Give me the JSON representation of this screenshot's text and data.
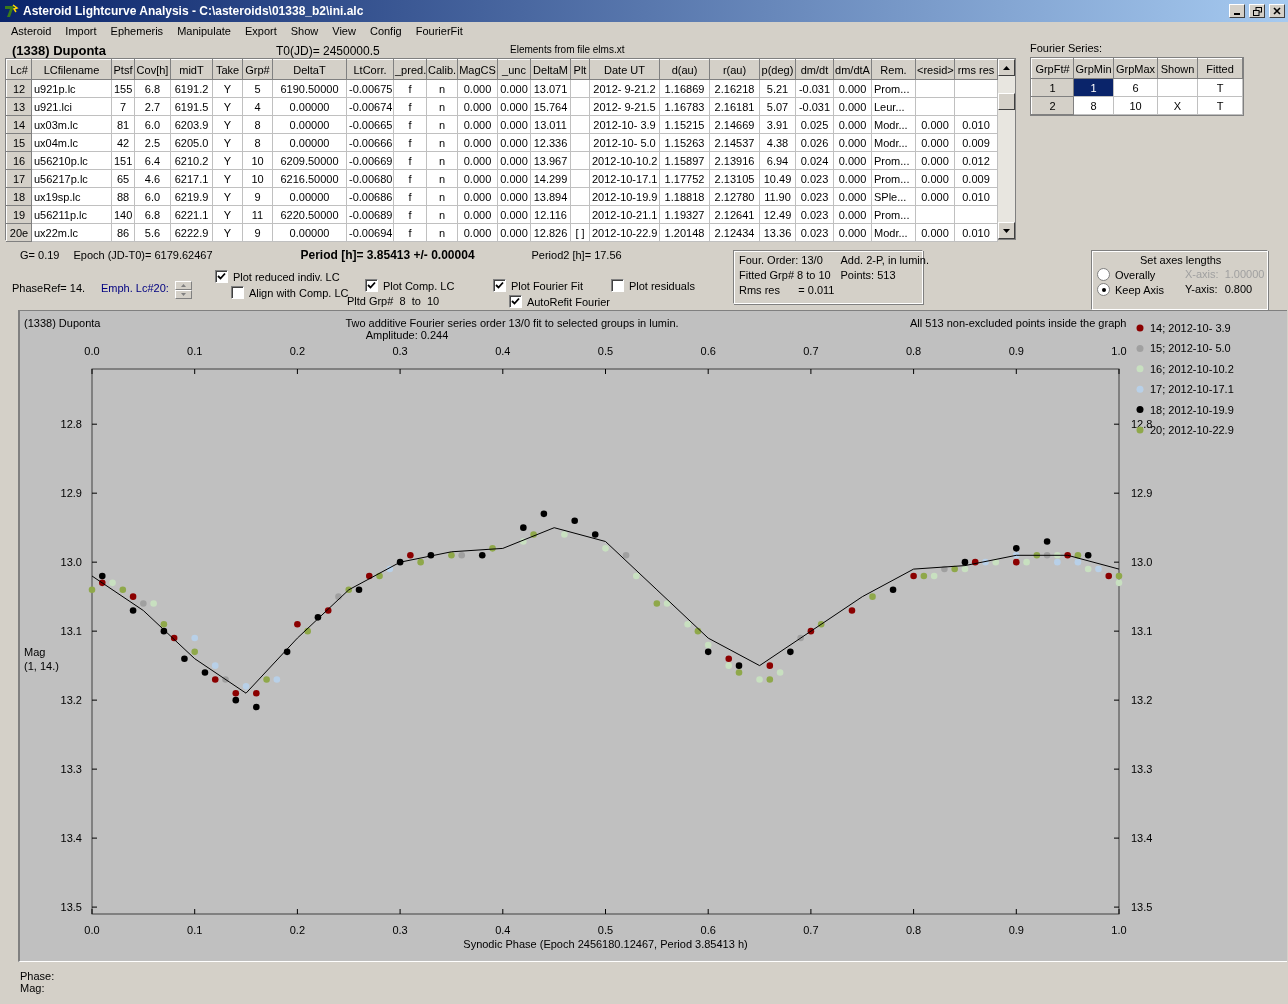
{
  "window": {
    "title": "Asteroid Lightcurve Analysis - C:\\asteroids\\01338_b2\\ini.alc"
  },
  "menu": [
    "Asteroid",
    "Import",
    "Ephemeris",
    "Manipulate",
    "Export",
    "Show",
    "View",
    "Config",
    "FourierFit"
  ],
  "header": {
    "object": "(1338) Duponta",
    "t0": "T0(JD)= 2450000.5",
    "elements": "Elements from file elms.xt"
  },
  "table": {
    "columns": [
      "Lc#",
      "LCfilename",
      "Ptsf",
      "Cov[h]",
      "midT",
      "Take",
      "Grp#",
      "DeltaT",
      "LtCorr.",
      "_pred.",
      "Calib.",
      "MagCS",
      "_unc",
      "DeltaM",
      "Plt",
      "Date UT",
      "d(au)",
      "r(au)",
      "p(deg)",
      "dm/dt",
      "dm/dtA",
      "Rem.",
      "<resid>",
      "rms res"
    ],
    "rows": [
      [
        "12",
        "u921p.lc",
        "155",
        "6.8",
        "6191.2",
        "Y",
        "5",
        "6190.50000",
        "-0.00675",
        "f",
        "n",
        "0.000",
        "0.000",
        "13.071",
        null,
        "2012- 9-21.2",
        "1.16869",
        "2.16218",
        "5.21",
        "-0.031",
        "0.000",
        "Prom...",
        null,
        null
      ],
      [
        "13",
        "u921.lci",
        "7",
        "2.7",
        "6191.5",
        "Y",
        "4",
        "0.00000",
        "-0.00674",
        "f",
        "n",
        "0.000",
        "0.000",
        "15.764",
        null,
        "2012- 9-21.5",
        "1.16783",
        "2.16181",
        "5.07",
        "-0.031",
        "0.000",
        "Leur...",
        null,
        null
      ],
      [
        "14",
        "ux03m.lc",
        "81",
        "6.0",
        "6203.9",
        "Y",
        "8",
        "0.00000",
        "-0.00665",
        "f",
        "n",
        "0.000",
        "0.000",
        "13.011",
        null,
        "2012-10- 3.9",
        "1.15215",
        "2.14669",
        "3.91",
        "0.025",
        "0.000",
        "Modr...",
        "0.000",
        "0.010"
      ],
      [
        "15",
        "ux04m.lc",
        "42",
        "2.5",
        "6205.0",
        "Y",
        "8",
        "0.00000",
        "-0.00666",
        "f",
        "n",
        "0.000",
        "0.000",
        "12.336",
        null,
        "2012-10- 5.0",
        "1.15263",
        "2.14537",
        "4.38",
        "0.026",
        "0.000",
        "Modr...",
        "0.000",
        "0.009"
      ],
      [
        "16",
        "u56210p.lc",
        "151",
        "6.4",
        "6210.2",
        "Y",
        "10",
        "6209.50000",
        "-0.00669",
        "f",
        "n",
        "0.000",
        "0.000",
        "13.967",
        null,
        "2012-10-10.2",
        "1.15897",
        "2.13916",
        "6.94",
        "0.024",
        "0.000",
        "Prom...",
        "0.000",
        "0.012"
      ],
      [
        "17",
        "u56217p.lc",
        "65",
        "4.6",
        "6217.1",
        "Y",
        "10",
        "6216.50000",
        "-0.00680",
        "f",
        "n",
        "0.000",
        "0.000",
        "14.299",
        null,
        "2012-10-17.1",
        "1.17752",
        "2.13105",
        "10.49",
        "0.023",
        "0.000",
        "Prom...",
        "0.000",
        "0.009"
      ],
      [
        "18",
        "ux19sp.lc",
        "88",
        "6.0",
        "6219.9",
        "Y",
        "9",
        "0.00000",
        "-0.00686",
        "f",
        "n",
        "0.000",
        "0.000",
        "13.894",
        null,
        "2012-10-19.9",
        "1.18818",
        "2.12780",
        "11.90",
        "0.023",
        "0.000",
        "SPle...",
        "0.000",
        "0.010"
      ],
      [
        "19",
        "u56211p.lc",
        "140",
        "6.8",
        "6221.1",
        "Y",
        "11",
        "6220.50000",
        "-0.00689",
        "f",
        "n",
        "0.000",
        "0.000",
        "12.116",
        null,
        "2012-10-21.1",
        "1.19327",
        "2.12641",
        "12.49",
        "0.023",
        "0.000",
        "Prom...",
        null,
        null
      ],
      [
        "20e",
        "ux22m.lc",
        "86",
        "5.6",
        "6222.9",
        "Y",
        "9",
        "0.00000",
        "-0.00694",
        "f",
        "n",
        "0.000",
        "0.000",
        "12.826",
        "[ ]",
        "2012-10-22.9",
        "1.20148",
        "2.12434",
        "13.36",
        "0.023",
        "0.000",
        "Modr...",
        "0.000",
        "0.010"
      ]
    ]
  },
  "fourier": {
    "title": "Fourier Series:",
    "columns": [
      "GrpFt#",
      "GrpMin",
      "GrpMax",
      "Shown",
      "Fitted"
    ],
    "rows": [
      {
        "cells": [
          {
            "text": "1",
            "selected": false
          },
          {
            "text": "1",
            "selected": true
          },
          {
            "text": "6",
            "selected": false
          },
          {
            "text": "",
            "selected": false
          },
          {
            "text": "T",
            "selected": false
          }
        ]
      },
      {
        "cells": [
          {
            "text": "2",
            "selected": false
          },
          {
            "text": "8",
            "selected": false
          },
          {
            "text": "10",
            "selected": false
          },
          {
            "text": "X",
            "selected": false
          },
          {
            "text": "T",
            "selected": false
          }
        ]
      }
    ]
  },
  "info": {
    "g": "G= 0.19",
    "epoch": "Epoch (JD-T0)= 6179.62467",
    "period": "Period [h]= 3.85413 +/- 0.00004",
    "period2": "Period2 [h]= 17.56",
    "phase_ref": "PhaseRef= 14.",
    "emph": "Emph. Lc#20:",
    "pltd_grp": "Pltd Grp#  8  to  10"
  },
  "checkboxes": [
    {
      "label": "Plot reduced indiv. LC",
      "checked": true
    },
    {
      "label": "Align with Comp. LC",
      "checked": false
    },
    {
      "label": "Plot Comp. LC",
      "checked": true
    },
    {
      "label": "Plot Fourier Fit",
      "checked": true
    },
    {
      "label": "Plot residuals",
      "checked": false
    },
    {
      "label": "AutoRefit Fourier",
      "checked": true
    }
  ],
  "fit_summary": [
    "Four. Order: 13/0",
    "Add. 2-P, in lumin.",
    "Fitted Grp# 8 to 10",
    "Points: 513",
    "Rms res      = 0.011"
  ],
  "axes": {
    "title": "Set axes lengths",
    "radios": [
      {
        "label": "Overally",
        "selected": false
      },
      {
        "label": "Keep Axis",
        "selected": true
      }
    ],
    "fields": [
      {
        "label": "X-axis:",
        "value": "1.00000",
        "disabled": true
      },
      {
        "label": "Y-axis:",
        "value": "0.800",
        "disabled": false
      }
    ]
  },
  "plot": {
    "object": "(1338) Duponta",
    "title": "Two additive Fourier series order 13/0 fit to selected groups in lumin.",
    "amplitude": "Amplitude: 0.244",
    "note": "All 513 non-excluded points inside the graph",
    "ylabel_note": "(1, 14.)",
    "chart_data": {
      "type": "scatter",
      "xlabel": "Synodic Phase (Epoch 2456180.12467, Period 3.85413 h)",
      "ylabel": "Mag",
      "xlim": [
        0,
        1
      ],
      "ylim": [
        13.51,
        12.72
      ],
      "legend": true,
      "xticks": [
        {
          "value": 0,
          "label": "0.0"
        },
        {
          "value": 0.1,
          "label": "0.1"
        },
        {
          "value": 0.2,
          "label": "0.2"
        },
        {
          "value": 0.3,
          "label": "0.3"
        },
        {
          "value": 0.4,
          "label": "0.4"
        },
        {
          "value": 0.5,
          "label": "0.5"
        },
        {
          "value": 0.6,
          "label": "0.6"
        },
        {
          "value": 0.7,
          "label": "0.7"
        },
        {
          "value": 0.8,
          "label": "0.8"
        },
        {
          "value": 0.9,
          "label": "0.9"
        },
        {
          "value": 1,
          "label": "1.0"
        }
      ],
      "yticks": [
        {
          "value": 12.8,
          "label": "12.8"
        },
        {
          "value": 12.9,
          "label": "12.9"
        },
        {
          "value": 13,
          "label": "13.0"
        },
        {
          "value": 13.1,
          "label": "13.1"
        },
        {
          "value": 13.2,
          "label": "13.2"
        },
        {
          "value": 13.3,
          "label": "13.3"
        },
        {
          "value": 13.4,
          "label": "13.4"
        },
        {
          "value": 13.5,
          "label": "13.5"
        }
      ],
      "series": [
        {
          "name": "14; 2012-10- 3.9",
          "color": "#8b0000",
          "x": [
            0.01,
            0.04,
            0.08,
            0.12,
            0.14,
            0.16,
            0.2,
            0.23,
            0.27,
            0.31,
            0.62,
            0.66,
            0.7,
            0.74,
            0.8,
            0.86,
            0.9,
            0.95,
            0.99
          ],
          "values": [
            13.03,
            13.05,
            13.11,
            13.17,
            13.19,
            13.19,
            13.09,
            13.07,
            13.02,
            12.99,
            13.14,
            13.15,
            13.1,
            13.07,
            13.02,
            13.0,
            13.0,
            12.99,
            13.02
          ]
        },
        {
          "name": "15; 2012-10- 5.0",
          "color": "#a0a0a0",
          "x": [
            0.05,
            0.13,
            0.24,
            0.36,
            0.52,
            0.69,
            0.83,
            0.93
          ],
          "values": [
            13.06,
            13.17,
            13.05,
            12.99,
            12.99,
            13.11,
            13.01,
            12.99
          ]
        },
        {
          "name": "16; 2012-10-10.2",
          "color": "#c8e0c0",
          "x": [
            0.02,
            0.06,
            0.42,
            0.46,
            0.5,
            0.53,
            0.56,
            0.58,
            0.6,
            0.62,
            0.65,
            0.67,
            0.82,
            0.85,
            0.88,
            0.91,
            0.94,
            0.97,
            1.0
          ],
          "values": [
            13.03,
            13.06,
            12.97,
            12.96,
            12.98,
            13.02,
            13.06,
            13.09,
            13.12,
            13.15,
            13.17,
            13.16,
            13.02,
            13.01,
            13.0,
            13.0,
            12.99,
            13.01,
            13.03
          ]
        },
        {
          "name": "17; 2012-10-17.1",
          "color": "#b8d0e8",
          "x": [
            0.1,
            0.12,
            0.15,
            0.18,
            0.29,
            0.87,
            0.9,
            0.94,
            0.96,
            0.98
          ],
          "values": [
            13.11,
            13.15,
            13.18,
            13.17,
            13.01,
            13.0,
            12.99,
            13.0,
            13.0,
            13.01
          ]
        },
        {
          "name": "18; 2012-10-19.9",
          "color": "#000000",
          "x": [
            0.01,
            0.04,
            0.07,
            0.09,
            0.11,
            0.14,
            0.16,
            0.19,
            0.22,
            0.26,
            0.3,
            0.33,
            0.38,
            0.42,
            0.44,
            0.47,
            0.49,
            0.6,
            0.63,
            0.68,
            0.78,
            0.85,
            0.9,
            0.93,
            0.97
          ],
          "values": [
            13.02,
            13.07,
            13.1,
            13.14,
            13.16,
            13.2,
            13.21,
            13.13,
            13.08,
            13.04,
            13.0,
            12.99,
            12.99,
            12.95,
            12.93,
            12.94,
            12.96,
            13.13,
            13.15,
            13.13,
            13.04,
            13.0,
            12.98,
            12.97,
            12.99
          ]
        },
        {
          "name": "20; 2012-10-22.9",
          "color": "#8fa84a",
          "x": [
            0.0,
            0.03,
            0.07,
            0.1,
            0.17,
            0.21,
            0.25,
            0.28,
            0.32,
            0.35,
            0.39,
            0.43,
            0.55,
            0.59,
            0.63,
            0.66,
            0.71,
            0.76,
            0.81,
            0.84,
            0.92,
            0.96,
            1.0
          ],
          "values": [
            13.04,
            13.04,
            13.09,
            13.13,
            13.17,
            13.1,
            13.04,
            13.02,
            13.0,
            12.99,
            12.98,
            12.96,
            13.06,
            13.1,
            13.16,
            13.17,
            13.09,
            13.05,
            13.02,
            13.01,
            12.99,
            12.99,
            13.02
          ]
        },
        {
          "type": "line",
          "color": "#000000",
          "x": [
            0,
            0.05,
            0.1,
            0.15,
            0.2,
            0.25,
            0.3,
            0.35,
            0.4,
            0.45,
            0.5,
            0.55,
            0.6,
            0.65,
            0.7,
            0.75,
            0.8,
            0.85,
            0.9,
            0.95,
            1.0
          ],
          "values": [
            13.02,
            13.07,
            13.14,
            13.19,
            13.11,
            13.04,
            13.0,
            12.985,
            12.98,
            12.95,
            12.97,
            13.04,
            13.11,
            13.15,
            13.1,
            13.05,
            13.01,
            13.005,
            12.99,
            12.99,
            13.01
          ]
        }
      ]
    }
  },
  "status": {
    "phase": "Phase:",
    "mag": "Mag:"
  }
}
